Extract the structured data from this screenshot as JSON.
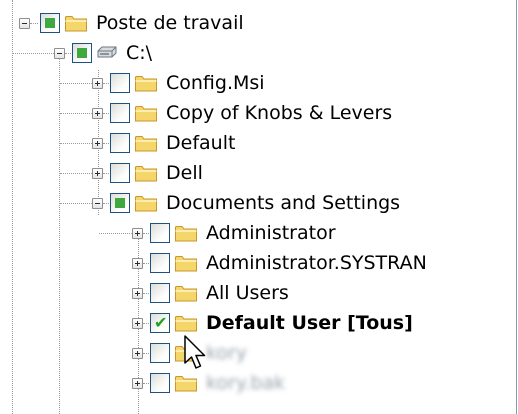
{
  "tree": {
    "root": {
      "label": "Poste de travail",
      "icon": "folder-icon",
      "checkbox": "partial",
      "expander": "minus"
    },
    "drive": {
      "label": "C:\\",
      "icon": "drive-icon",
      "checkbox": "partial",
      "expander": "minus"
    },
    "drive_children": [
      {
        "label": "Config.Msi",
        "checkbox": "unchecked",
        "expander": "plus"
      },
      {
        "label": "Copy of Knobs & Levers",
        "checkbox": "unchecked",
        "expander": "plus"
      },
      {
        "label": "Default",
        "checkbox": "unchecked",
        "expander": "plus"
      },
      {
        "label": "Dell",
        "checkbox": "unchecked",
        "expander": "plus"
      },
      {
        "label": "Documents and Settings",
        "checkbox": "partial",
        "expander": "minus"
      }
    ],
    "settings_children": [
      {
        "label": "Administrator",
        "checkbox": "unchecked",
        "expander": "plus"
      },
      {
        "label": "Administrator.SYSTRAN",
        "checkbox": "unchecked",
        "expander": "plus"
      },
      {
        "label": "All Users",
        "checkbox": "unchecked",
        "expander": "plus"
      },
      {
        "label": "Default User [Tous]",
        "checkbox": "checked",
        "expander": "plus",
        "bold": true
      },
      {
        "label": "kory",
        "checkbox": "unchecked",
        "expander": "plus",
        "blurred": true
      },
      {
        "label": "kory.bak",
        "checkbox": "unchecked",
        "expander": "plus",
        "blurred": true
      }
    ]
  },
  "colors": {
    "partial_fill": "#3fa93f",
    "check_mark": "#21a121",
    "checkbox_border": "#1c5180",
    "folder_fill": "#f5d66b",
    "folder_stroke": "#c8962c"
  },
  "cursor": {
    "icon": "mouse-pointer-icon"
  }
}
